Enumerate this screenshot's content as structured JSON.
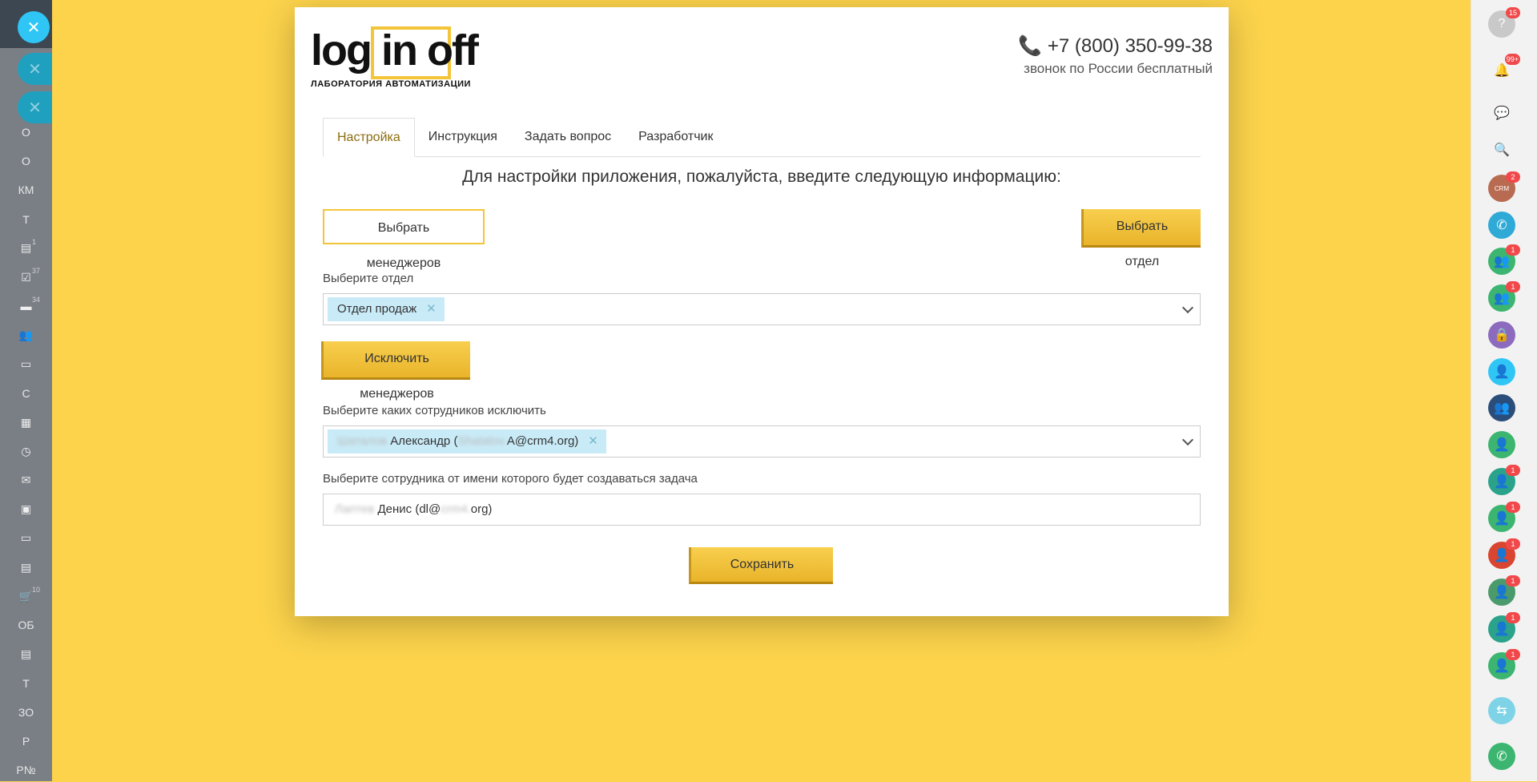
{
  "left_sidebar": {
    "close_icon": "close-icon",
    "items": [
      {
        "label": "О"
      },
      {
        "label": "О"
      },
      {
        "label": "КМ"
      },
      {
        "label": "Т"
      },
      {
        "icon": "document-icon",
        "count": "1"
      },
      {
        "icon": "checkbox-icon",
        "count": "37"
      },
      {
        "icon": "chat-icon",
        "count": "34"
      },
      {
        "icon": "group-icon"
      },
      {
        "icon": "drive-icon"
      },
      {
        "label": "С"
      },
      {
        "icon": "calendar-icon"
      },
      {
        "icon": "clock-icon"
      },
      {
        "icon": "mail-icon"
      },
      {
        "icon": "robot-icon"
      },
      {
        "icon": "window-icon"
      },
      {
        "icon": "contact-card-icon"
      },
      {
        "icon": "cart-icon",
        "count": "10"
      },
      {
        "label": "ОБ"
      },
      {
        "icon": "file-icon"
      },
      {
        "label": "Т"
      },
      {
        "label": "ЗО"
      },
      {
        "label": "Р"
      },
      {
        "label": "Р№"
      }
    ]
  },
  "right_sidebar": {
    "help_badge": "15",
    "notifications_badge": "99+",
    "crm_badge": "2",
    "crm_label": "CRM",
    "contact_badges": [
      "1",
      "1",
      "1",
      "1",
      "1",
      "1",
      "1",
      "1"
    ]
  },
  "modal": {
    "logo_text": "log in off",
    "logo_subtitle": "ЛАБОРАТОРИЯ АВТОМАТИЗАЦИИ",
    "phone_number": "+7 (800) 350-99-38",
    "phone_note": "звонок по России бесплатный",
    "tabs": [
      {
        "label": "Настройка",
        "active": true
      },
      {
        "label": "Инструкция"
      },
      {
        "label": "Задать вопрос"
      },
      {
        "label": "Разработчик"
      }
    ],
    "heading": "Для настройки приложения, пожалуйста, введите следующую информацию:",
    "choose_managers_button": "Выбрать менеджеров",
    "choose_department_button": "Выбрать отдел",
    "department_label": "Выберите отдел",
    "department_chip": "Отдел продаж",
    "exclude_managers_button": "Исключить менеджеров",
    "exclude_label": "Выберите каких сотрудников исключить",
    "exclude_chip_prefix_blurred": "Шаталов",
    "exclude_chip_name": "Александр (",
    "exclude_chip_email_blurred": "Shatalov.",
    "exclude_chip_email": "A@crm4.org)",
    "task_author_label": "Выберите сотрудника от имени которого будет создаваться задача",
    "task_author_blurred": "Лаптев",
    "task_author_name": "Денис (dl@",
    "task_author_email_blurred": "crm4.",
    "task_author_email_tail": "org)",
    "save_button": "Сохранить"
  }
}
